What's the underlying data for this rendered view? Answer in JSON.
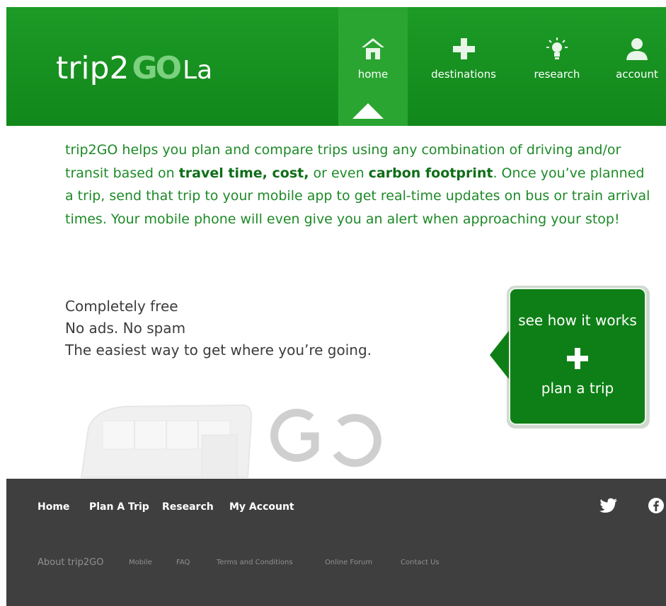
{
  "header": {
    "logo": {
      "prefix": "trip2",
      "go": "GO",
      "suffix": "La"
    },
    "nav": [
      {
        "label": "home",
        "icon": "home-icon",
        "active": true
      },
      {
        "label": "destinations",
        "icon": "plus-icon"
      },
      {
        "label": "research",
        "icon": "lightbulb-icon"
      },
      {
        "label": "account",
        "icon": "user-icon"
      }
    ]
  },
  "intro": {
    "p1": "trip2GO helps you plan and compare trips using any combination of driving and/or transit based on ",
    "b1": "travel time, cost,",
    "p2": " or even ",
    "b2": "carbon footprint",
    "p3": ". Once you’ve planned a trip, send that trip to your mobile app to get real-time updates on bus or train arrival times. Your mobile phone will even give you an alert when approaching your stop!"
  },
  "features": [
    "Completely free",
    "No ads. No spam",
    "The easiest way to get where you’re going."
  ],
  "cta": {
    "top": "see how it works",
    "bottom": "plan a trip"
  },
  "footer": {
    "nav": [
      "Home",
      "Plan A Trip",
      "Research",
      "My Account"
    ],
    "sub": [
      "About trip2GO",
      "Mobile",
      "FAQ",
      "Terms and Conditions",
      "Online Forum",
      "Contact Us"
    ]
  },
  "colors": {
    "brand_green": "#1c9a26",
    "cta_green": "#0e7f16",
    "footer_bg": "#3f3f3f"
  }
}
